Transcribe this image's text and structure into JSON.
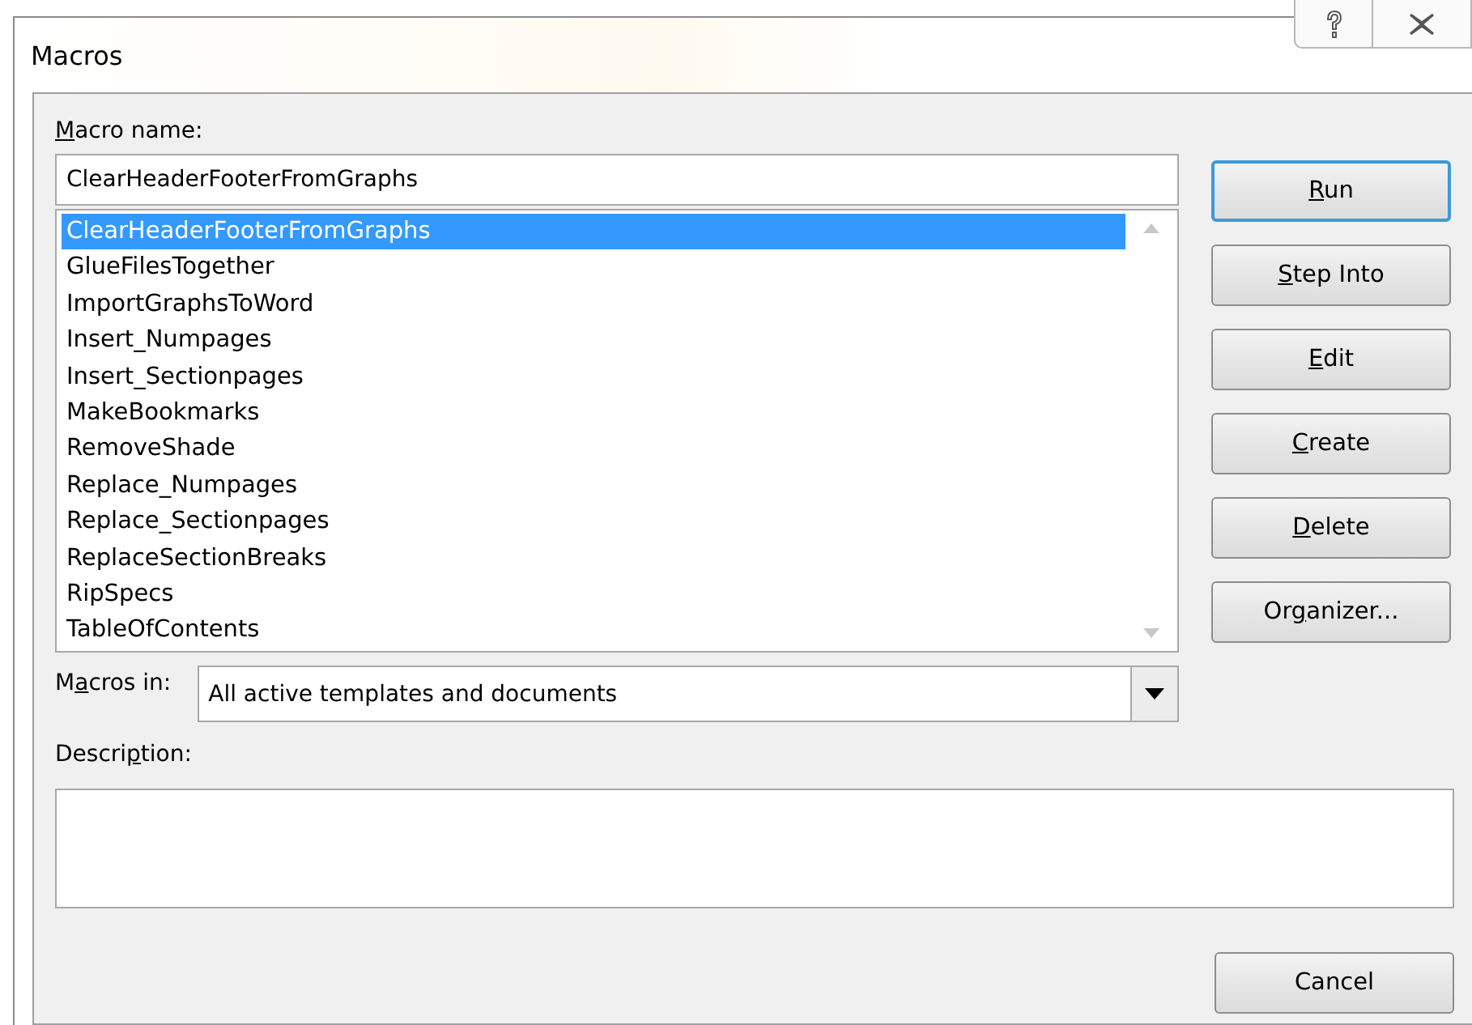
{
  "window": {
    "title": "Macros"
  },
  "macro_name": {
    "label": {
      "key": "M",
      "post": "acro name:"
    },
    "value": "ClearHeaderFooterFromGraphs"
  },
  "macro_list": [
    {
      "label": "ClearHeaderFooterFromGraphs",
      "selected": true
    },
    {
      "label": "GlueFilesTogether",
      "selected": false
    },
    {
      "label": "ImportGraphsToWord",
      "selected": false
    },
    {
      "label": "Insert_Numpages",
      "selected": false
    },
    {
      "label": "Insert_Sectionpages",
      "selected": false
    },
    {
      "label": "MakeBookmarks",
      "selected": false
    },
    {
      "label": "RemoveShade",
      "selected": false
    },
    {
      "label": "Replace_Numpages",
      "selected": false
    },
    {
      "label": "Replace_Sectionpages",
      "selected": false
    },
    {
      "label": "ReplaceSectionBreaks",
      "selected": false
    },
    {
      "label": "RipSpecs",
      "selected": false
    },
    {
      "label": "TableOfContents",
      "selected": false
    }
  ],
  "buttons": [
    {
      "key": "R",
      "post": "un",
      "default": true
    },
    {
      "key": "S",
      "post": "tep Into",
      "default": false
    },
    {
      "key": "E",
      "post": "dit",
      "default": false
    },
    {
      "key": "C",
      "post": "reate",
      "default": false
    },
    {
      "key": "D",
      "post": "elete",
      "default": false
    },
    {
      "pre": "Or",
      "key": "g",
      "post": "anizer...",
      "default": false
    }
  ],
  "macros_in": {
    "label": {
      "pre": "M",
      "key": "a",
      "post": "cros in:"
    },
    "value": "All active templates and documents"
  },
  "description": {
    "label": {
      "pre": "Descri",
      "key": "p",
      "post": "tion:"
    }
  },
  "cancel_button": {
    "label": "Cancel"
  }
}
